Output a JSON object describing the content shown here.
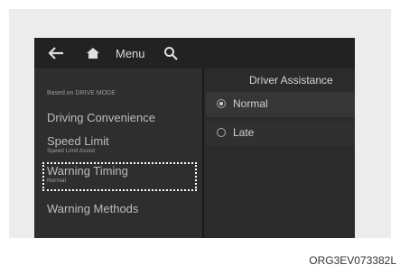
{
  "topbar": {
    "back_icon": "arrow-left-icon",
    "home_icon": "home-icon",
    "menu_label": "Menu",
    "search_icon": "search-icon"
  },
  "sidebar": {
    "based_on": "Based on DRIVE MODE",
    "items": [
      {
        "title": "Driving Convenience",
        "subtitle": ""
      },
      {
        "title": "Speed Limit",
        "subtitle": "Speed Limit Assist"
      },
      {
        "title": "Warning Timing",
        "subtitle": "Normal"
      },
      {
        "title": "Warning Methods",
        "subtitle": ""
      }
    ]
  },
  "panel": {
    "title": "Driver Assistance",
    "options": [
      {
        "label": "Normal",
        "selected": true
      },
      {
        "label": "Late",
        "selected": false
      }
    ]
  },
  "caption": "ORG3EV073382L",
  "colors": {
    "screen_bg": "#2b2b2b",
    "topbar_bg": "#222222",
    "text": "#bdbdbd",
    "focus": "#ffffff"
  }
}
